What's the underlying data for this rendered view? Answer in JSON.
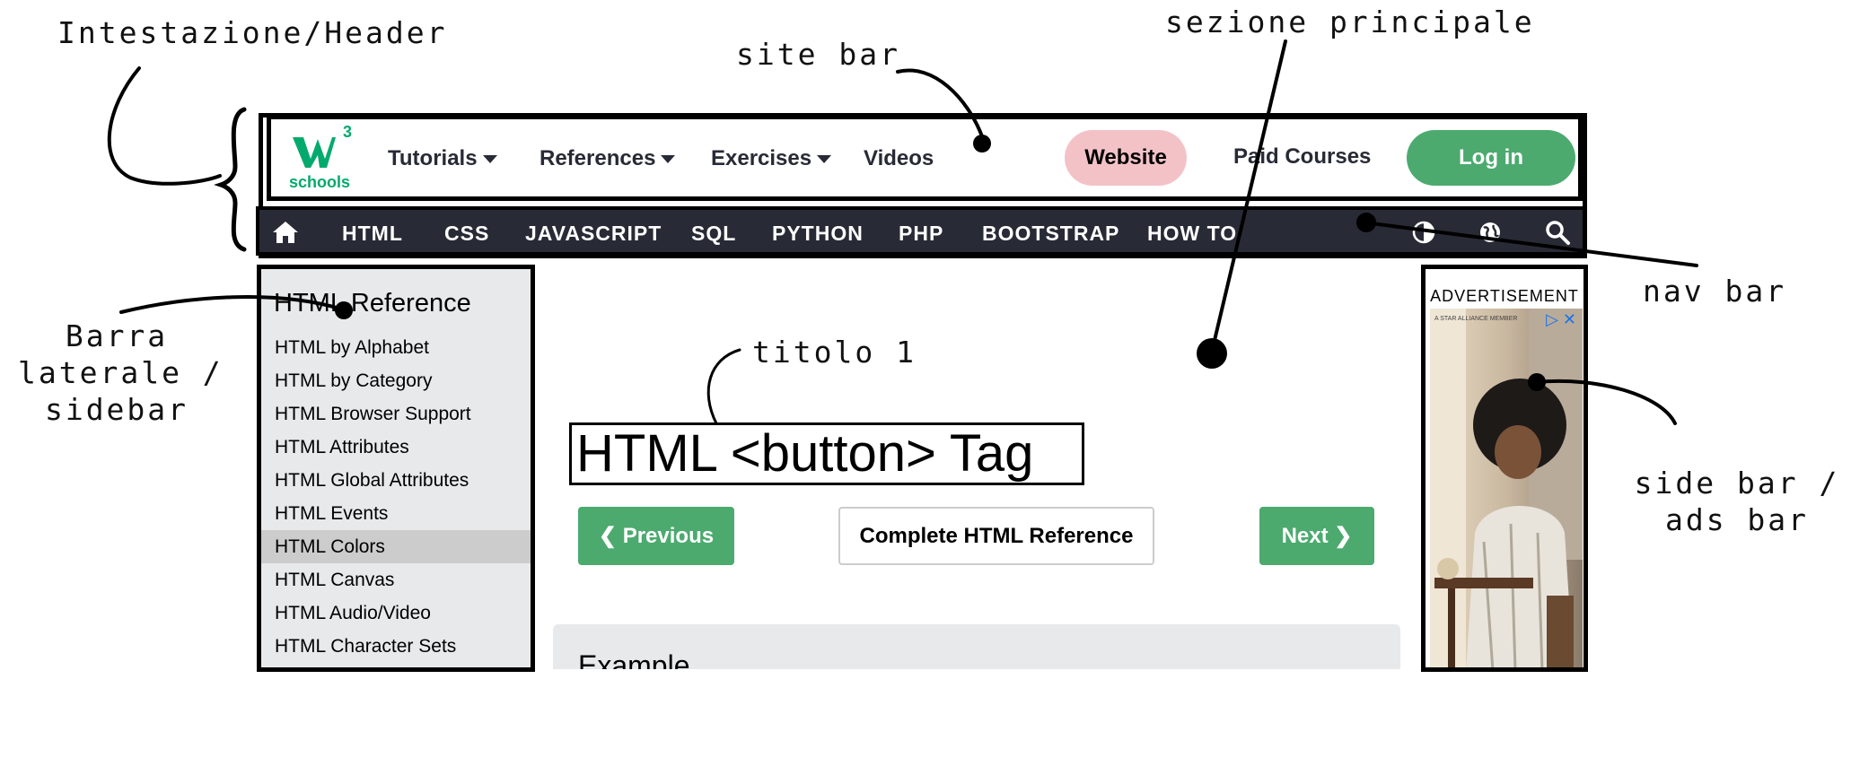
{
  "annotations": {
    "header": "Intestazione/Header",
    "site_bar": "site bar",
    "main_section": "sezione principale",
    "nav_bar": "nav bar",
    "sidebar": "Barra\nlaterale /\nsidebar",
    "title1": "titolo 1",
    "ads_bar": "side bar /\nads bar"
  },
  "site_bar": {
    "logo_sup": "3",
    "logo_text": "schools",
    "menu": {
      "tutorials": "Tutorials",
      "references": "References",
      "exercises": "Exercises",
      "videos": "Videos"
    },
    "website_button": "Website",
    "paid_courses": "Paid Courses",
    "login_button": "Log in"
  },
  "nav_bar": {
    "items": [
      "HTML",
      "CSS",
      "JAVASCRIPT",
      "SQL",
      "PYTHON",
      "PHP",
      "BOOTSTRAP",
      "HOW TO"
    ],
    "icons": [
      "home-icon",
      "contrast-icon",
      "globe-icon",
      "search-icon"
    ]
  },
  "sidebar": {
    "title": "HTML Reference",
    "items": [
      "HTML by Alphabet",
      "HTML by Category",
      "HTML Browser Support",
      "HTML Attributes",
      "HTML Global Attributes",
      "HTML Events",
      "HTML Colors",
      "HTML Canvas",
      "HTML Audio/Video",
      "HTML Character Sets"
    ],
    "active_index": 6
  },
  "main": {
    "title": "HTML <button> Tag",
    "prev_button": "❮ Previous",
    "ref_button": "Complete HTML Reference",
    "next_button": "Next ❯",
    "example_title": "Example"
  },
  "ads": {
    "label": "ADVERTISEMENT",
    "fine_print": "A STAR ALLIANCE MEMBER"
  },
  "colors": {
    "brand_green": "#04aa6d",
    "button_green": "#4caa6f",
    "nav_dark": "#282a35",
    "website_pink": "#f3c2c7",
    "sidebar_bg": "#e7e9eb"
  }
}
